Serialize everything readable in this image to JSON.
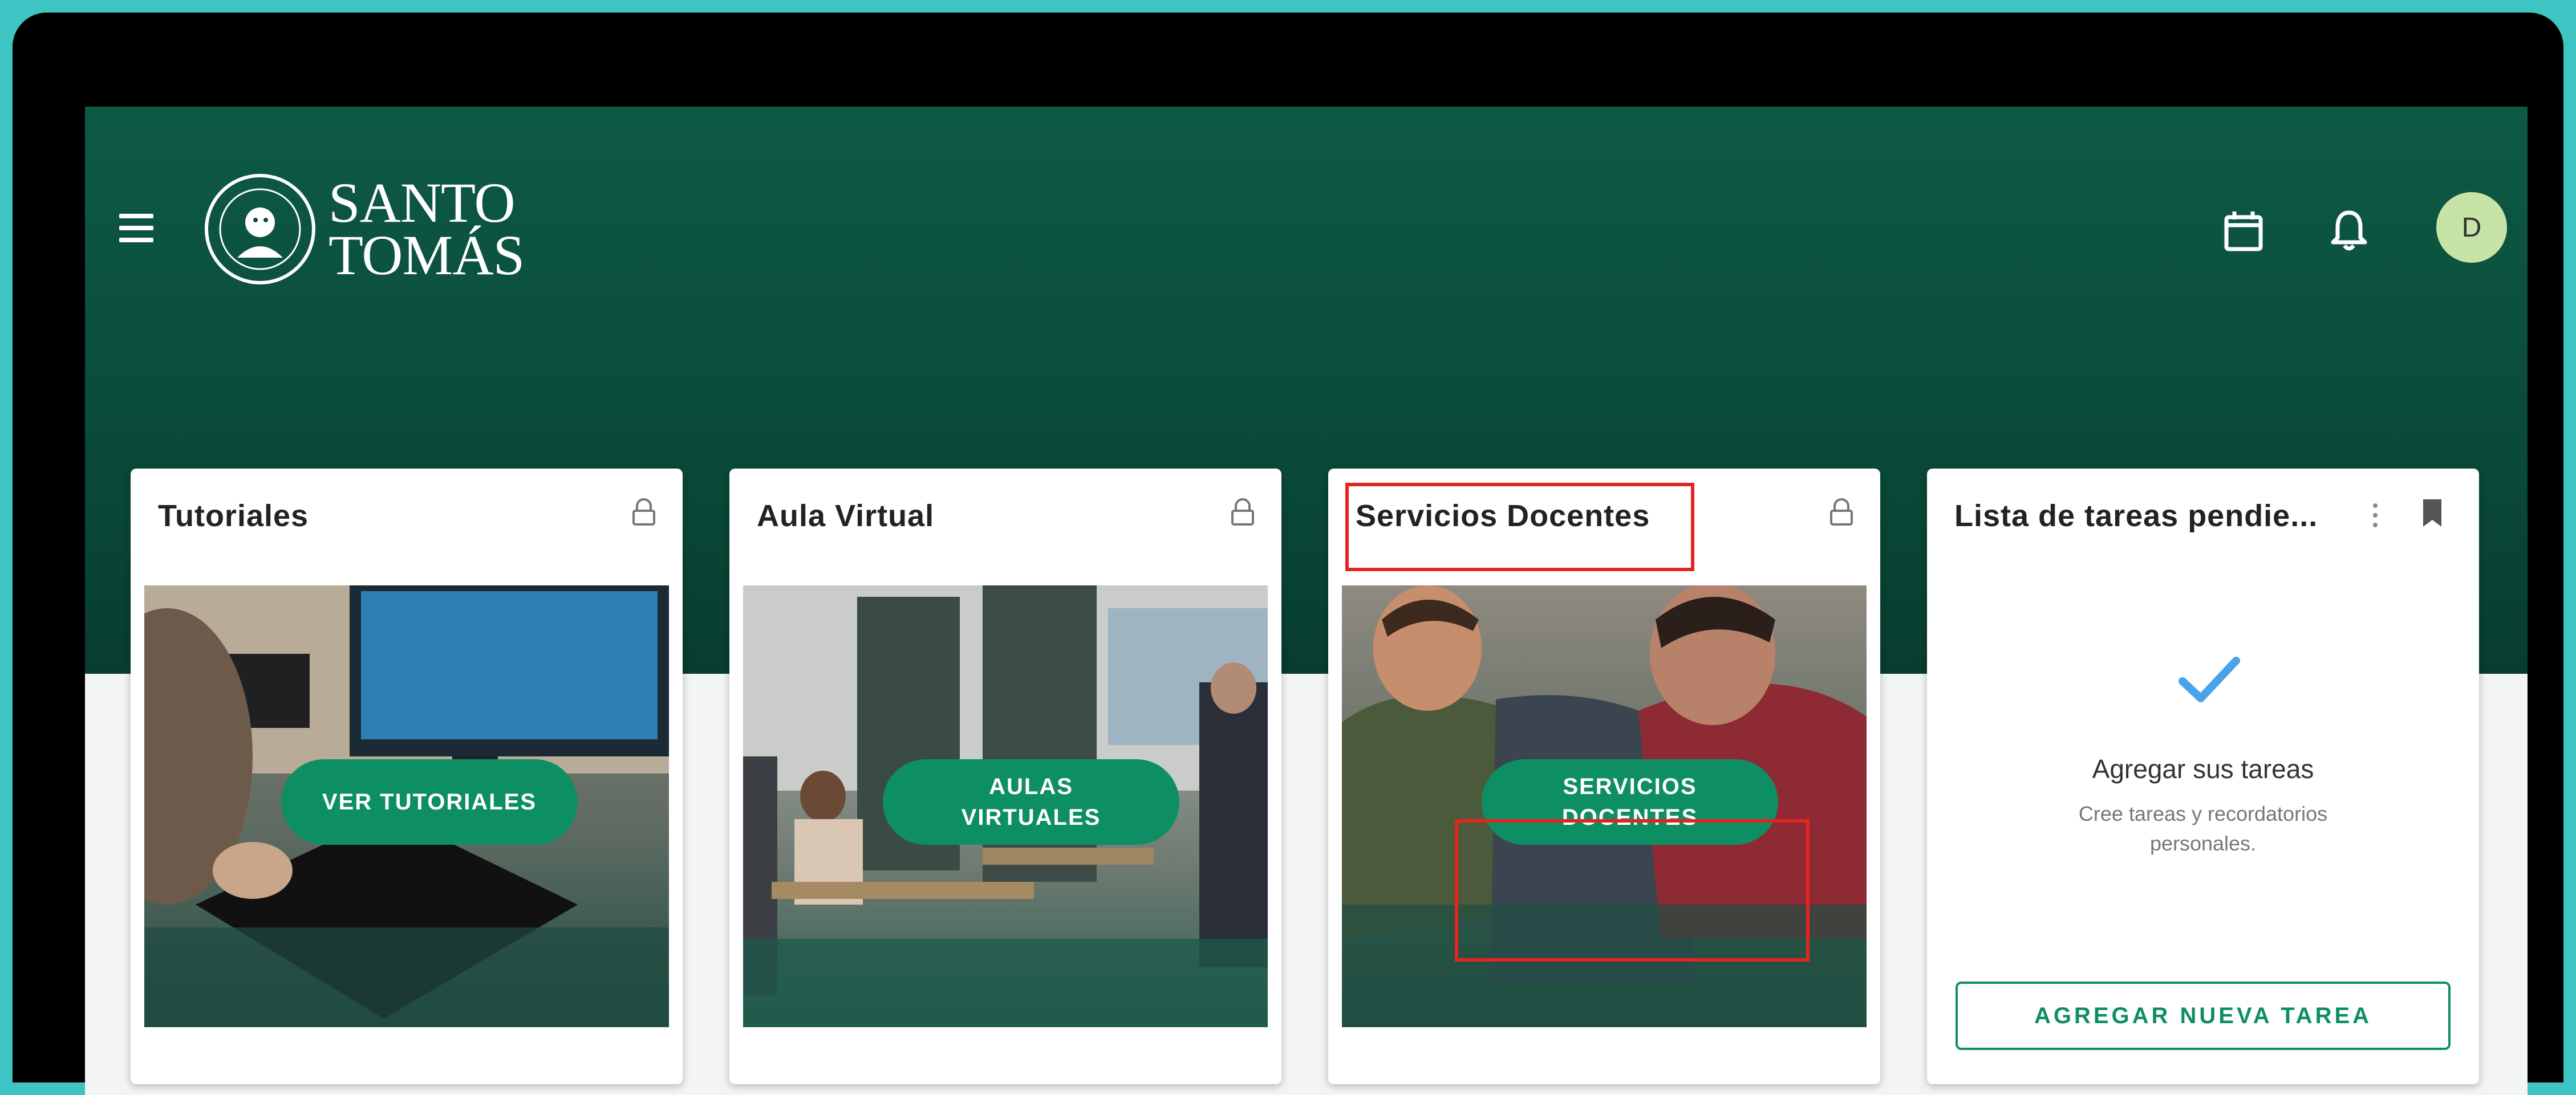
{
  "header": {
    "logo_line1": "SANTO",
    "logo_line2": "TOMÁS"
  },
  "avatar": {
    "initial": "D"
  },
  "cards": [
    {
      "title": "Tutoriales",
      "button": "VER TUTORIALES"
    },
    {
      "title": "Aula Virtual",
      "button_line1": "AULAS",
      "button_line2": "VIRTUALES"
    },
    {
      "title": "Servicios Docentes",
      "button_line1": "SERVICIOS",
      "button_line2": "DOCENTES"
    },
    {
      "title": "Lista de tareas pendie...",
      "empty_title": "Agregar sus tareas",
      "empty_sub_line1": "Cree tareas y recordatorios",
      "empty_sub_line2": "personales.",
      "button": "AGREGAR NUEVA TAREA"
    }
  ],
  "icons": {
    "menu": "hamburger-menu-icon",
    "calendar": "calendar-icon",
    "notifications": "bell-icon",
    "lock": "lock-icon",
    "kebab": "more-vertical-icon",
    "bookmark": "bookmark-icon",
    "check": "check-icon"
  },
  "colors": {
    "brand_dark_green": "#0a4a39",
    "button_green": "#0e8f63",
    "highlight_red": "#e52421",
    "avatar_bg": "#c7e4a6",
    "check_blue": "#4aa3e8",
    "outer_bg": "#3fc4c4"
  }
}
